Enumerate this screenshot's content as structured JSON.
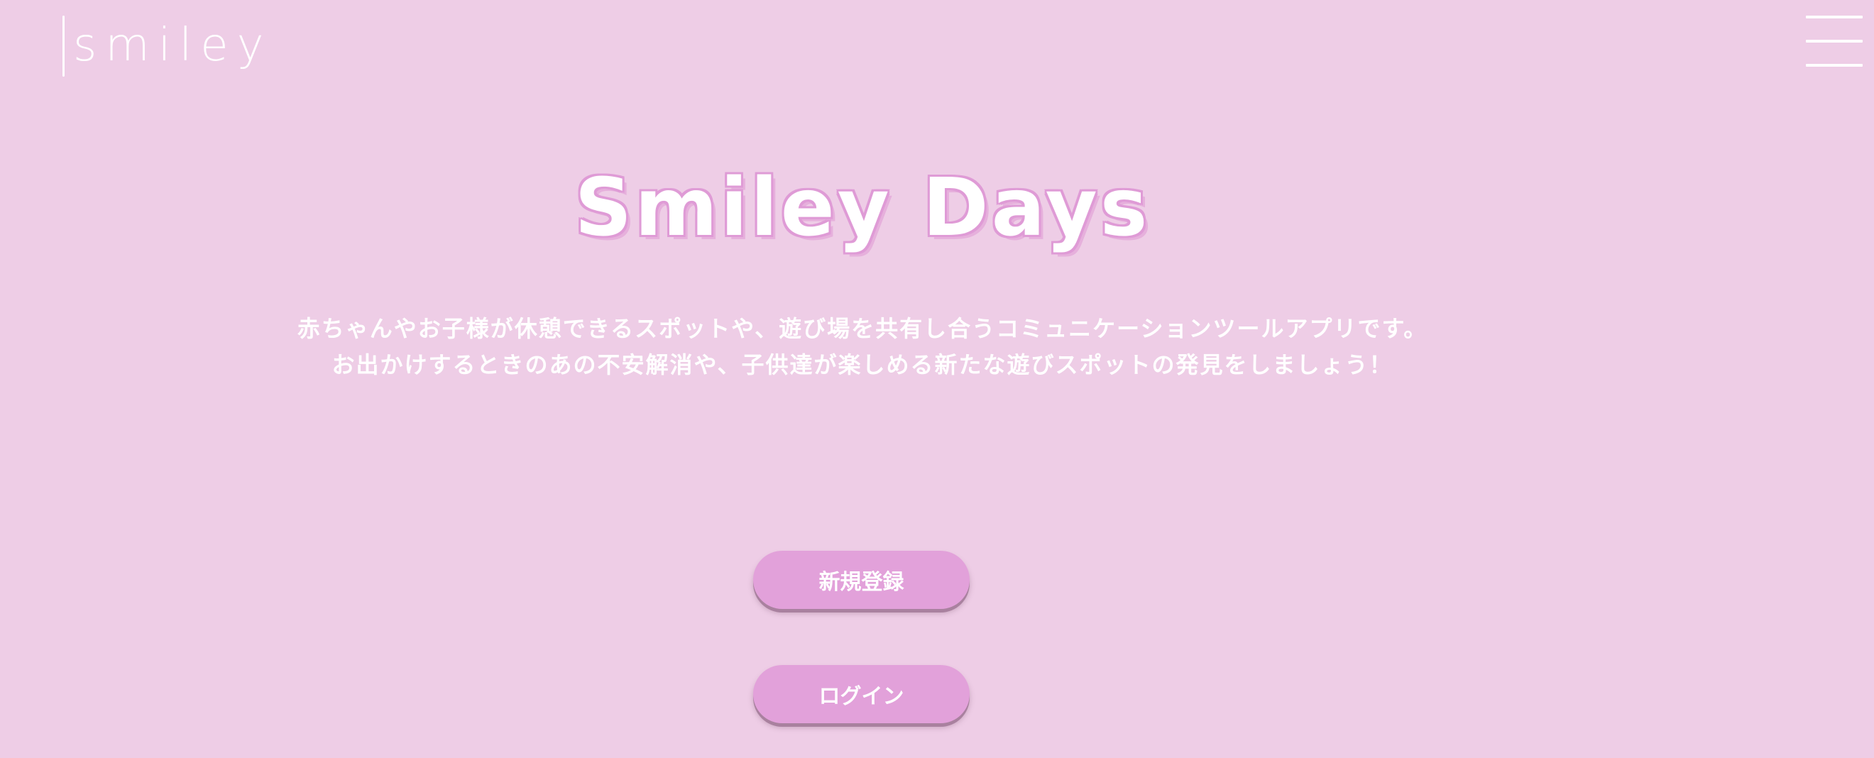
{
  "header": {
    "logo_text": "smiley",
    "menu_icon": "hamburger-menu-icon"
  },
  "hero": {
    "title": "Smiley Days",
    "description_lines": [
      "赤ちゃんやお子様が休憩できるスポットや、遊び場を共有し合うコミュニケーションツールアプリです。",
      "お出かけするときのあの不安解消や、子供達が楽しめる新たな遊びスポットの発見をしましょう！"
    ]
  },
  "actions": {
    "register_label": "新規登録",
    "login_label": "ログイン"
  },
  "colors": {
    "background": "#eecde6",
    "accent": "#e2a1da",
    "title_outline": "#df9bd6",
    "text": "#ffffff"
  }
}
